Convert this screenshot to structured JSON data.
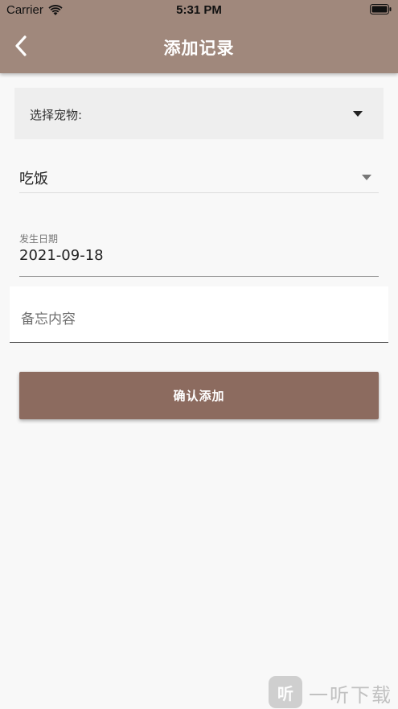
{
  "status_bar": {
    "carrier": "Carrier",
    "time": "5:31 PM"
  },
  "header": {
    "title": "添加记录",
    "background_color": "#a0887c"
  },
  "form": {
    "pet_select": {
      "label": "选择宠物:"
    },
    "event_select": {
      "value": "吃饭"
    },
    "date_field": {
      "label": "发生日期",
      "value": "2021-09-18"
    },
    "memo_field": {
      "placeholder": "备忘内容"
    },
    "confirm_button": {
      "label": "确认添加",
      "color": "#8c6b5f"
    }
  },
  "watermark": {
    "icon_glyph": "听",
    "text": "一听下载"
  },
  "icons": [
    "wifi-icon",
    "battery-icon",
    "back-arrow-icon",
    "dropdown-caret-icon"
  ]
}
